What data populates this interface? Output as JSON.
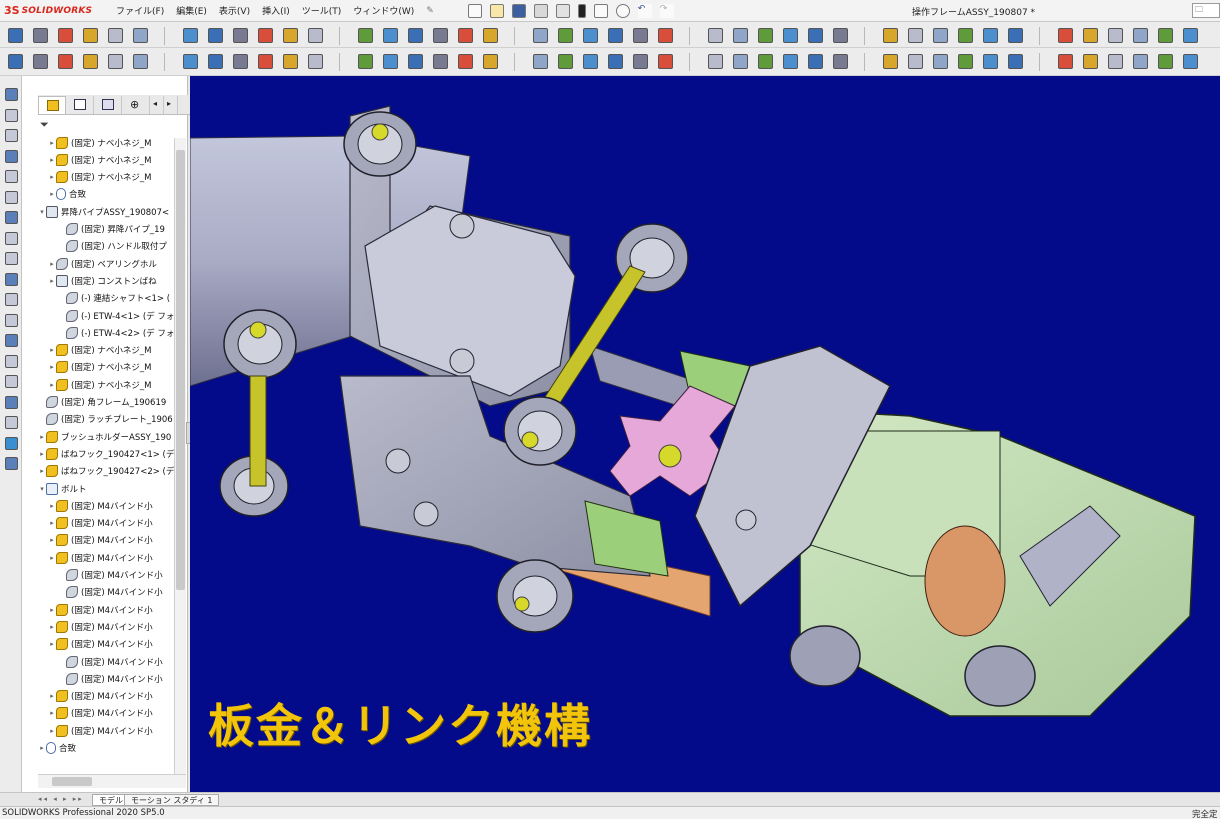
{
  "app": {
    "logo_mark": "3S",
    "logo_text": "SOLIDWORKS",
    "document_title": "操作フレームASSY_190807 *",
    "search_value": ""
  },
  "menu": [
    "ファイル(F)",
    "編集(E)",
    "表示(V)",
    "挿入(I)",
    "ツール(T)",
    "ウィンドウ(W)"
  ],
  "feature_tree": {
    "filter_icon": "funnel-icon",
    "rows": [
      {
        "label": "(固定) ナベ小ネジ_M",
        "icon": "part",
        "indent": 1,
        "twisty": "▸"
      },
      {
        "label": "(固定) ナベ小ネジ_M",
        "icon": "part",
        "indent": 1,
        "twisty": "▸"
      },
      {
        "label": "(固定) ナベ小ネジ_M",
        "icon": "part",
        "indent": 1,
        "twisty": "▸"
      },
      {
        "label": "合致",
        "icon": "mate",
        "indent": 1,
        "twisty": "▸"
      },
      {
        "label": "昇降パイプASSY_190807<",
        "icon": "asm",
        "indent": 0,
        "twisty": "▾"
      },
      {
        "label": "(固定) 昇降パイプ_19",
        "icon": "fix",
        "indent": 2,
        "twisty": ""
      },
      {
        "label": "(固定) ハンドル取付プ",
        "icon": "fix",
        "indent": 2,
        "twisty": ""
      },
      {
        "label": "(固定) ベアリングホル",
        "icon": "fix",
        "indent": 1,
        "twisty": "▸"
      },
      {
        "label": "(固定) コンストンばね",
        "icon": "asm",
        "indent": 1,
        "twisty": "▸"
      },
      {
        "label": "(-) 連結シャフト<1> (",
        "icon": "fix",
        "indent": 2,
        "twisty": ""
      },
      {
        "label": "(-) ETW-4<1> (デ フォ",
        "icon": "fix",
        "indent": 2,
        "twisty": ""
      },
      {
        "label": "(-) ETW-4<2> (デ フォ",
        "icon": "fix",
        "indent": 2,
        "twisty": ""
      },
      {
        "label": "(固定) ナベ小ネジ_M",
        "icon": "part",
        "indent": 1,
        "twisty": "▸"
      },
      {
        "label": "(固定) ナベ小ネジ_M",
        "icon": "part",
        "indent": 1,
        "twisty": "▸"
      },
      {
        "label": "(固定) ナベ小ネジ_M",
        "icon": "part",
        "indent": 1,
        "twisty": "▸"
      },
      {
        "label": "(固定) 角フレーム_190619",
        "icon": "fix",
        "indent": 0,
        "twisty": ""
      },
      {
        "label": "(固定) ラッチプレート_1906",
        "icon": "fix",
        "indent": 0,
        "twisty": ""
      },
      {
        "label": "ブッシュホルダーASSY_190",
        "icon": "part",
        "indent": 0,
        "twisty": "▸"
      },
      {
        "label": "ばねフック_190427<1> (デ",
        "icon": "part",
        "indent": 0,
        "twisty": "▸"
      },
      {
        "label": "ばねフック_190427<2> (デ",
        "icon": "part",
        "indent": 0,
        "twisty": "▸"
      },
      {
        "label": "ボルト",
        "icon": "folder",
        "indent": 0,
        "twisty": "▾"
      },
      {
        "label": "(固定) M4バインド小",
        "icon": "part",
        "indent": 1,
        "twisty": "▸"
      },
      {
        "label": "(固定) M4バインド小",
        "icon": "part",
        "indent": 1,
        "twisty": "▸"
      },
      {
        "label": "(固定) M4バインド小",
        "icon": "part",
        "indent": 1,
        "twisty": "▸"
      },
      {
        "label": "(固定) M4バインド小",
        "icon": "part",
        "indent": 1,
        "twisty": "▸"
      },
      {
        "label": "(固定) M4バインド小",
        "icon": "fix",
        "indent": 2,
        "twisty": ""
      },
      {
        "label": "(固定) M4バインド小",
        "icon": "fix",
        "indent": 2,
        "twisty": ""
      },
      {
        "label": "(固定) M4バインド小",
        "icon": "part",
        "indent": 1,
        "twisty": "▸"
      },
      {
        "label": "(固定) M4バインド小",
        "icon": "part",
        "indent": 1,
        "twisty": "▸"
      },
      {
        "label": "(固定) M4バインド小",
        "icon": "part",
        "indent": 1,
        "twisty": "▸"
      },
      {
        "label": "(固定) M4バインド小",
        "icon": "fix",
        "indent": 2,
        "twisty": ""
      },
      {
        "label": "(固定) M4バインド小",
        "icon": "fix",
        "indent": 2,
        "twisty": ""
      },
      {
        "label": "(固定) M4バインド小",
        "icon": "part",
        "indent": 1,
        "twisty": "▸"
      },
      {
        "label": "(固定) M4バインド小",
        "icon": "part",
        "indent": 1,
        "twisty": "▸"
      },
      {
        "label": "(固定) M4バインド小",
        "icon": "part",
        "indent": 1,
        "twisty": "▸"
      },
      {
        "label": "合致",
        "icon": "mate",
        "indent": 0,
        "twisty": "▸"
      }
    ]
  },
  "bottom_tabs": {
    "model": "モデル",
    "motion_study": "モーション スタディ 1"
  },
  "status": {
    "left": "SOLIDWORKS Professional 2020 SP5.0",
    "right": "完全定"
  },
  "viewport": {
    "caption": "板金＆リンク機構",
    "background": "#040b8a"
  }
}
